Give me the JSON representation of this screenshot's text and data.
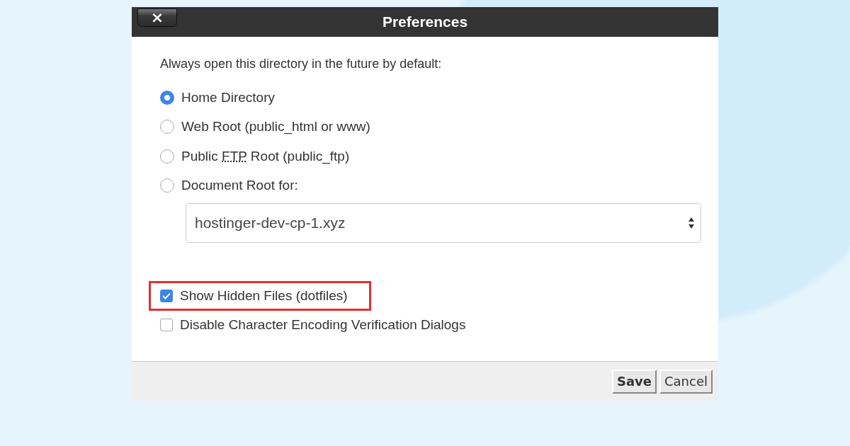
{
  "dialog": {
    "title": "Preferences",
    "close_label": "×"
  },
  "prompt": "Always open this directory in the future by default:",
  "directory_options": [
    {
      "parts": [
        "Home Directory"
      ],
      "selected": true
    },
    {
      "parts": [
        "Web Root (public_html or www)"
      ],
      "selected": false
    },
    {
      "parts": [
        "Public ",
        "FTP",
        " Root (public_ftp)"
      ],
      "selected": false
    },
    {
      "parts": [
        "Document Root for:"
      ],
      "selected": false
    }
  ],
  "domain_select": {
    "value": "hostinger-dev-cp-1.xyz"
  },
  "checkboxes": [
    {
      "label": "Show Hidden Files (dotfiles)",
      "checked": true,
      "highlighted": true
    },
    {
      "label": "Disable Character Encoding Verification Dialogs",
      "checked": false,
      "highlighted": false
    }
  ],
  "buttons": [
    {
      "label": "Save",
      "kind": "primary"
    },
    {
      "label": "Cancel",
      "kind": "secondary"
    }
  ]
}
